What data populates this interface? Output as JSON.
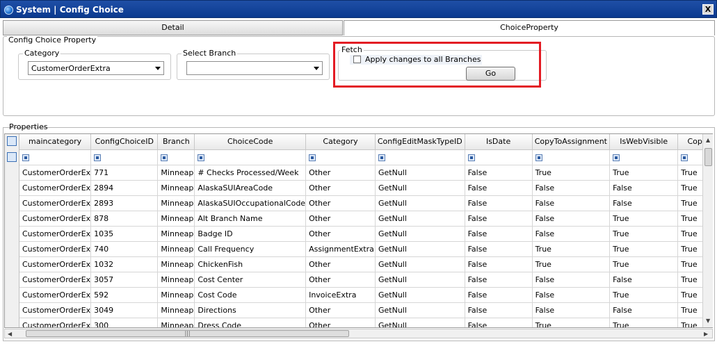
{
  "window": {
    "title": "System | Config Choice",
    "close_label": "X"
  },
  "tabs": [
    {
      "label": "Detail"
    },
    {
      "label": "ChoiceProperty"
    }
  ],
  "config": {
    "group_title": "Config Choice Property",
    "category_label": "Category",
    "category_value": "CustomerOrderExtra",
    "branch_label": "Select Branch",
    "branch_value": "",
    "fetch_label": "Fetch",
    "apply_label": "Apply changes to all Branches",
    "go_label": "Go"
  },
  "properties": {
    "label": "Properties",
    "columns": [
      "maincategory",
      "ConfigChoiceID",
      "Branch",
      "ChoiceCode",
      "Category",
      "ConfigEditMaskTypeID",
      "IsDate",
      "CopyToAssignment",
      "IsWebVisible",
      "Cop"
    ],
    "rows": [
      [
        "CustomerOrderEx",
        "771",
        "Minneap",
        "# Checks Processed/Week",
        "Other",
        "GetNull",
        "False",
        "True",
        "True",
        "True"
      ],
      [
        "CustomerOrderEx",
        "2894",
        "Minneap",
        "AlaskaSUIAreaCode",
        "Other",
        "GetNull",
        "False",
        "False",
        "False",
        "True"
      ],
      [
        "CustomerOrderEx",
        "2893",
        "Minneap",
        "AlaskaSUIOccupationalCode",
        "Other",
        "GetNull",
        "False",
        "False",
        "False",
        "True"
      ],
      [
        "CustomerOrderEx",
        "878",
        "Minneap",
        "Alt Branch Name",
        "Other",
        "GetNull",
        "False",
        "False",
        "True",
        "True"
      ],
      [
        "CustomerOrderEx",
        "1035",
        "Minneap",
        "Badge ID",
        "Other",
        "GetNull",
        "False",
        "False",
        "True",
        "True"
      ],
      [
        "CustomerOrderEx",
        "740",
        "Minneap",
        "Call Frequency",
        "AssignmentExtra",
        "GetNull",
        "False",
        "True",
        "True",
        "True"
      ],
      [
        "CustomerOrderEx",
        "1032",
        "Minneap",
        "ChickenFish",
        "Other",
        "GetNull",
        "False",
        "True",
        "True",
        "True"
      ],
      [
        "CustomerOrderEx",
        "3057",
        "Minneap",
        "Cost Center",
        "Other",
        "GetNull",
        "False",
        "False",
        "False",
        "True"
      ],
      [
        "CustomerOrderEx",
        "592",
        "Minneap",
        "Cost Code",
        "InvoiceExtra",
        "GetNull",
        "False",
        "False",
        "True",
        "True"
      ],
      [
        "CustomerOrderEx",
        "3049",
        "Minneap",
        "Directions",
        "Other",
        "GetNull",
        "False",
        "False",
        "False",
        "True"
      ],
      [
        "CustomerOrderEx",
        "300",
        "Minneap",
        "Dress Code",
        "Other",
        "GetNull",
        "False",
        "True",
        "True",
        "True"
      ]
    ]
  },
  "colors": {
    "title_bar": "#0b3a8f",
    "highlight": "#e31b23"
  }
}
